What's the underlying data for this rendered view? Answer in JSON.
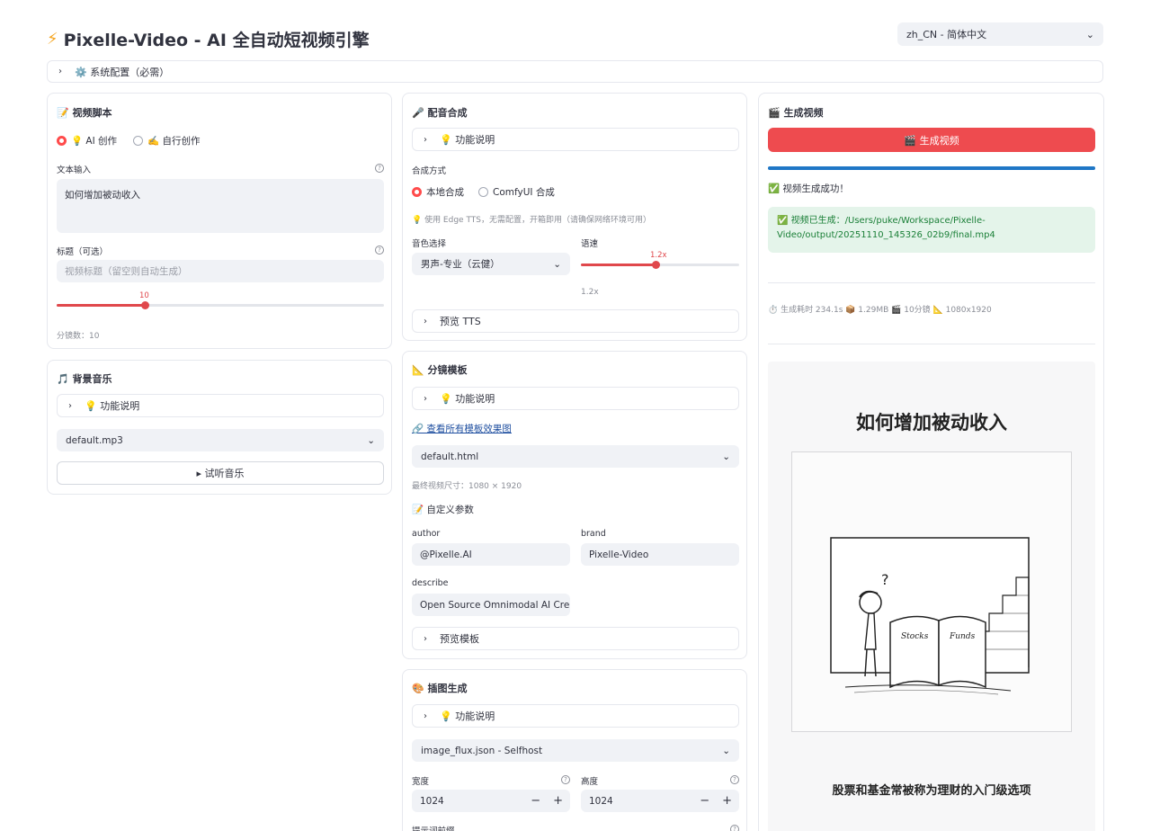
{
  "header": {
    "icon": "lightning-icon",
    "title": "Pixelle-Video - AI 全自动短视频引擎"
  },
  "language_select": {
    "value": "zh_CN - 简体中文"
  },
  "system_config": {
    "label": "⚙️ 系统配置（必需）"
  },
  "script_panel": {
    "title": "📝 视频脚本",
    "mode_ai": "💡 AI 创作",
    "mode_self": "✍️ 自行创作",
    "mode_selected": "ai",
    "text_label": "文本输入",
    "text_value": "如何增加被动收入",
    "title_label": "标题（可选）",
    "title_placeholder": "视频标题（留空则自动生成）",
    "scenes_value": "10",
    "scenes_fraction": 0.27,
    "scenes_caption": "分镜数：10"
  },
  "bgm_panel": {
    "title": "🎵 背景音乐",
    "help_label": "💡 功能说明",
    "select_value": "default.mp3",
    "listen_button": "▸ 试听音乐"
  },
  "tts_panel": {
    "title": "🎤 配音合成",
    "help_label": "💡 功能说明",
    "method_label": "合成方式",
    "method_local": "本地合成",
    "method_comfy": "ComfyUI 合成",
    "method_selected": "local",
    "info": "💡 使用 Edge TTS，无需配置，开箱即用（请确保网络环境可用）",
    "voice_label": "音色选择",
    "voice_value": "男声-专业（云健）",
    "speed_label": "语速",
    "speed_value": "1.2x",
    "speed_fraction": 0.47,
    "speed_caption": "1.2x",
    "preview_label": "预览 TTS"
  },
  "template_panel": {
    "title": "📐 分镜模板",
    "help_label": "💡 功能说明",
    "link": "🔗 查看所有模板效果图",
    "select_value": "default.html",
    "size_caption": "最终视频尺寸：1080 × 1920",
    "custom_label": "📝 自定义参数",
    "author_label": "author",
    "author_value": "@Pixelle.AI",
    "brand_label": "brand",
    "brand_value": "Pixelle-Video",
    "describe_label": "describe",
    "describe_value": "Open Source Omnimodal AI Creative",
    "preview_label": "预览模板"
  },
  "image_panel": {
    "title": "🎨 插图生成",
    "help_label": "💡 功能说明",
    "select_value": "image_flux.json - Selfhost",
    "width_label": "宽度",
    "width_value": "1024",
    "height_label": "高度",
    "height_value": "1024",
    "prompt_label": "提示词前缀"
  },
  "generate_panel": {
    "title": "🎬 生成视频",
    "button": "🎬 生成视频",
    "progress": 1.0,
    "success": "✅ 视频生成成功！",
    "path_box": "✅ 视频已生成：/Users/puke/Workspace/Pixelle-Video/output/20251110_145326_02b9/final.mp4",
    "stats": "⏱️ 生成耗时 234.1s 📦 1.29MB 🎬 10分镜 📐 1080x1920",
    "preview_headline": "如何增加被动收入",
    "preview_caption": "股票和基金常被称为理财的入门级选项",
    "preview_book_left": "Stocks",
    "preview_book_right": "Funds"
  },
  "colors": {
    "accent": "#ff4b4b",
    "progress": "#1f77c6",
    "success_bg": "#e4f4ea",
    "success_text": "#1a7f37"
  }
}
